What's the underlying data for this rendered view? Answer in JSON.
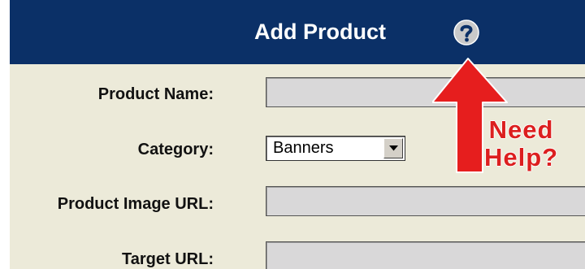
{
  "header": {
    "title": "Add Product",
    "help_icon": "question-circle-icon"
  },
  "form": {
    "product_name": {
      "label": "Product Name:",
      "value": ""
    },
    "category": {
      "label": "Category:",
      "selected": "Banners"
    },
    "product_image_url": {
      "label": "Product Image URL:",
      "value": ""
    },
    "target_url": {
      "label": "Target URL:",
      "value": ""
    }
  },
  "callout": {
    "line1": "Need",
    "line2": "Help?",
    "arrow_icon": "arrow-up-icon"
  },
  "colors": {
    "header_bg": "#0b3067",
    "panel_bg": "#ecead9",
    "field_bg": "#d9d8d9",
    "callout": "#dc1f1f"
  }
}
